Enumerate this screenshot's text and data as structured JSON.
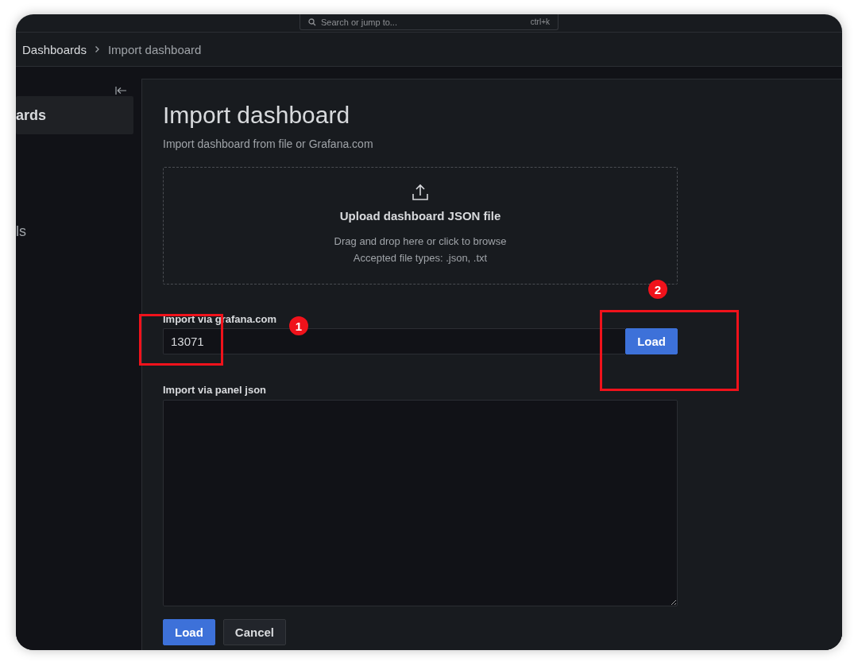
{
  "top_search": {
    "placeholder": "Search or jump to...",
    "shortcut": "ctrl+k"
  },
  "breadcrumbs": [
    {
      "label": "Dashboards",
      "selected": false
    },
    {
      "label": "Import dashboard",
      "selected": true
    }
  ],
  "sidebar": {
    "items": [
      {
        "label": "ards",
        "selected": true
      },
      {
        "label": "ls",
        "selected": false
      }
    ]
  },
  "page": {
    "title": "Import dashboard",
    "subtitle": "Import dashboard from file or Grafana.com",
    "upload": {
      "title": "Upload dashboard JSON file",
      "hint": "Drag and drop here or click to browse",
      "accepted": "Accepted file types: .json, .txt"
    },
    "grafana_import": {
      "label": "Import via grafana.com",
      "value": "13071",
      "button": "Load"
    },
    "panel_json": {
      "label": "Import via panel json"
    },
    "buttons": [
      {
        "label": "Load",
        "kind": "primary"
      },
      {
        "label": "Cancel",
        "kind": "secondary"
      }
    ]
  },
  "annotations": [
    {
      "number": "1"
    },
    {
      "number": "2"
    }
  ]
}
